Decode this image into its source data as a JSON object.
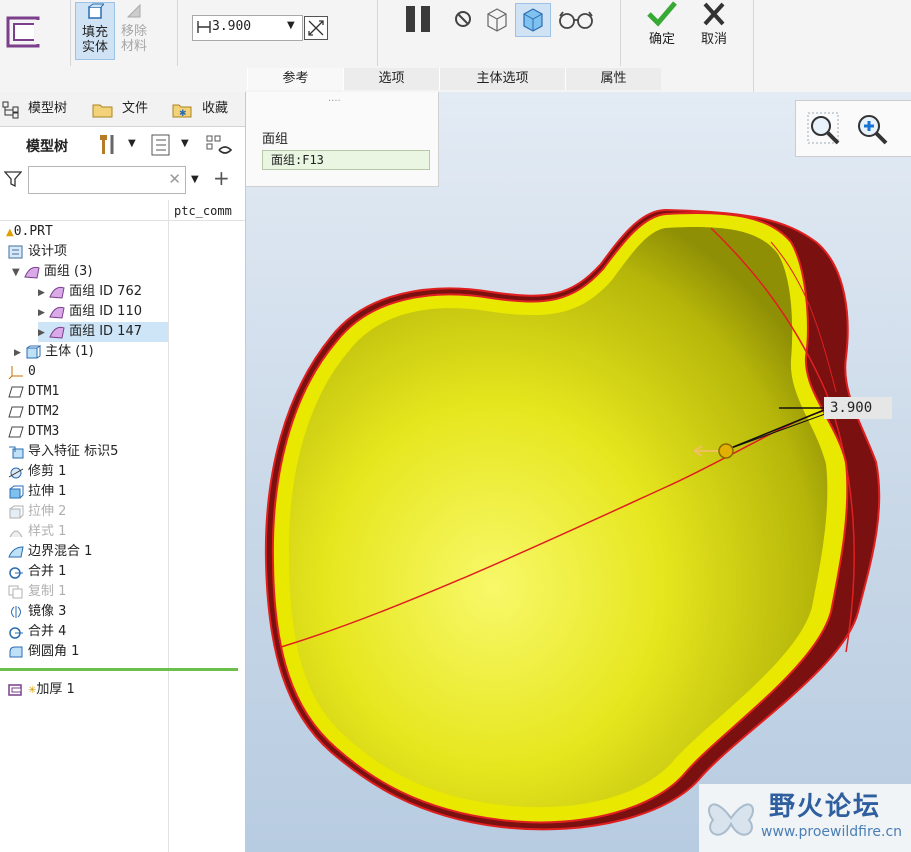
{
  "ribbon": {
    "fill_solid_label_1": "填充",
    "fill_solid_label_2": "实体",
    "remove_material_label_1": "移除",
    "remove_material_label_2": "材料",
    "thickness_value": "3.900",
    "confirm_label": "确定",
    "cancel_label": "取消",
    "tabs": [
      "参考",
      "选项",
      "主体选项",
      "属性"
    ]
  },
  "left_panel": {
    "tabs": [
      "模型树",
      "文件",
      "收藏"
    ],
    "header": "模型树",
    "column_header": "ptc_comm",
    "tree": [
      {
        "label": "0.PRT",
        "icon": "part-icon",
        "indent": 0,
        "disabled": false
      },
      {
        "label": "设计项",
        "icon": "design-item-icon",
        "indent": 0,
        "disabled": false
      },
      {
        "label": "面组 (3)",
        "icon": "quilt-icon",
        "indent": 1,
        "expander": "▼",
        "disabled": false
      },
      {
        "label": "面组 ID 762",
        "icon": "quilt-icon",
        "indent": 2,
        "expander": "▶",
        "disabled": false
      },
      {
        "label": "面组 ID 110",
        "icon": "quilt-icon",
        "indent": 2,
        "expander": "▶",
        "disabled": false
      },
      {
        "label": "面组 ID 147",
        "icon": "quilt-icon",
        "indent": 2,
        "expander": "▶",
        "disabled": false,
        "selected": true
      },
      {
        "label": "主体 (1)",
        "icon": "body-icon",
        "indent": 1,
        "expander": "▶",
        "disabled": false
      },
      {
        "label": "0",
        "icon": "csys-icon",
        "indent": 0,
        "disabled": false
      },
      {
        "label": "DTM1",
        "icon": "datum-plane-icon",
        "indent": 0,
        "disabled": false
      },
      {
        "label": "DTM2",
        "icon": "datum-plane-icon",
        "indent": 0,
        "disabled": false
      },
      {
        "label": "DTM3",
        "icon": "datum-plane-icon",
        "indent": 0,
        "disabled": false
      },
      {
        "label": "导入特征 标识5",
        "icon": "import-icon",
        "indent": 0,
        "disabled": false
      },
      {
        "label": "修剪 1",
        "icon": "trim-icon",
        "indent": 0,
        "disabled": false
      },
      {
        "label": "拉伸 1",
        "icon": "extrude-icon",
        "indent": 0,
        "disabled": false
      },
      {
        "label": "拉伸 2",
        "icon": "extrude-icon",
        "indent": 0,
        "disabled": true
      },
      {
        "label": "样式 1",
        "icon": "style-icon",
        "indent": 0,
        "disabled": true
      },
      {
        "label": "边界混合 1",
        "icon": "boundary-blend-icon",
        "indent": 0,
        "disabled": false
      },
      {
        "label": "合并 1",
        "icon": "merge-icon",
        "indent": 0,
        "disabled": false
      },
      {
        "label": "复制 1",
        "icon": "copy-icon",
        "indent": 0,
        "disabled": true
      },
      {
        "label": "镜像 3",
        "icon": "mirror-icon",
        "indent": 0,
        "disabled": false
      },
      {
        "label": "合并 4",
        "icon": "merge-icon",
        "indent": 0,
        "disabled": false
      },
      {
        "label": "倒圆角 1",
        "icon": "round-icon",
        "indent": 0,
        "disabled": false
      }
    ],
    "insert_item": "加厚 1"
  },
  "reference_panel": {
    "title": "面组",
    "value": "面组:F13"
  },
  "viewport": {
    "dimension_value": "3.900",
    "watermark_title": "野火论坛",
    "watermark_url": "www.proewildfire.cn",
    "model_color": "#ecec1a",
    "edge_color": "#e02020",
    "inner_color": "#7a1010"
  }
}
